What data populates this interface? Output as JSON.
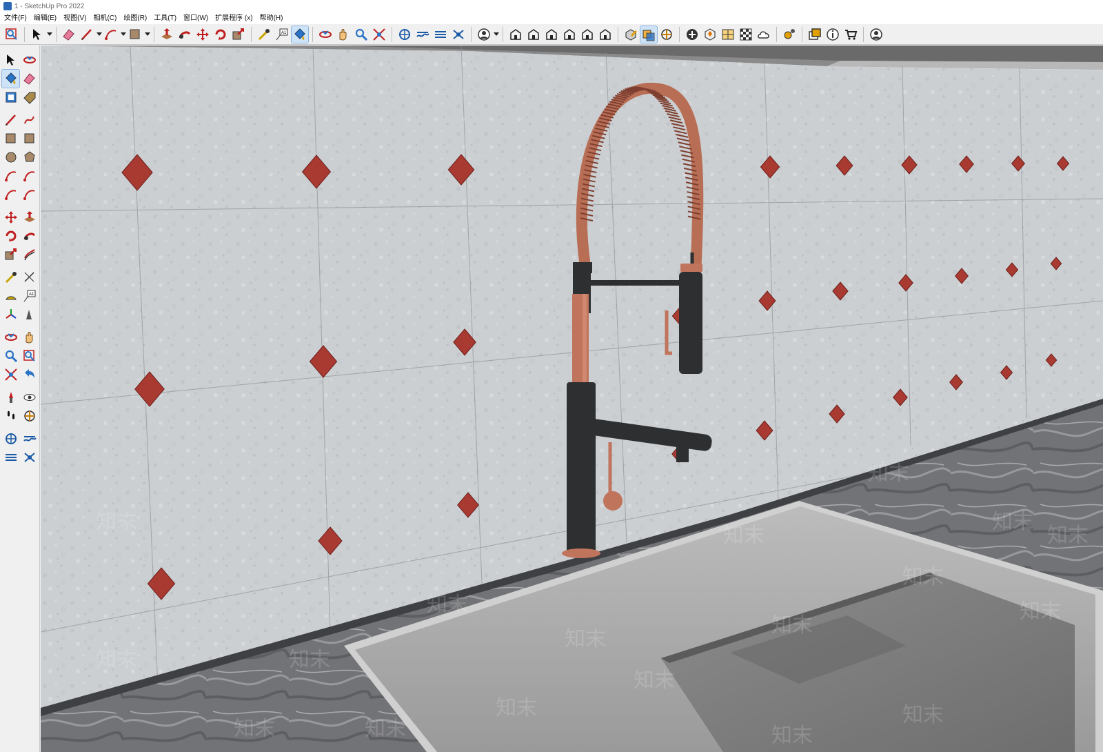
{
  "window": {
    "title": "1 - SketchUp Pro 2022"
  },
  "menu": [
    "文件(F)",
    "编辑(E)",
    "视图(V)",
    "相机(C)",
    "绘图(R)",
    "工具(T)",
    "窗口(W)",
    "扩展程序 (x)",
    "帮助(H)"
  ],
  "top_toolbar": [
    {
      "name": "zoom-window-icon",
      "type": "btn"
    },
    {
      "type": "sep"
    },
    {
      "name": "select-icon",
      "type": "btn"
    },
    {
      "type": "drop"
    },
    {
      "type": "sep"
    },
    {
      "name": "eraser-icon",
      "type": "btn"
    },
    {
      "name": "line-icon",
      "type": "btn"
    },
    {
      "type": "drop"
    },
    {
      "name": "arc-icon",
      "type": "btn"
    },
    {
      "type": "drop"
    },
    {
      "name": "rectangle-icon",
      "type": "btn"
    },
    {
      "type": "drop"
    },
    {
      "type": "sep"
    },
    {
      "name": "push-pull-icon",
      "type": "btn"
    },
    {
      "name": "follow-me-icon",
      "type": "btn"
    },
    {
      "name": "move-icon",
      "type": "btn"
    },
    {
      "name": "rotate-icon",
      "type": "btn"
    },
    {
      "name": "scale-icon",
      "type": "btn"
    },
    {
      "type": "sep"
    },
    {
      "name": "tape-measure-icon",
      "type": "btn"
    },
    {
      "name": "text-icon",
      "type": "btn"
    },
    {
      "name": "paint-bucket-icon",
      "type": "btn",
      "active": true
    },
    {
      "type": "sep"
    },
    {
      "name": "orbit-icon",
      "type": "btn"
    },
    {
      "name": "pan-icon",
      "type": "btn"
    },
    {
      "name": "zoom-icon",
      "type": "btn"
    },
    {
      "name": "zoom-extents-icon",
      "type": "btn"
    },
    {
      "type": "sep"
    },
    {
      "name": "warehouse-icon",
      "type": "btn"
    },
    {
      "name": "extension-warehouse-icon",
      "type": "btn"
    },
    {
      "name": "layout-icon",
      "type": "btn"
    },
    {
      "name": "extension-manager-icon",
      "type": "btn"
    },
    {
      "type": "sep"
    },
    {
      "name": "user-account-icon",
      "type": "btn"
    },
    {
      "type": "drop"
    },
    {
      "type": "sep"
    },
    {
      "name": "iso-view-icon",
      "type": "btn"
    },
    {
      "name": "top-view-icon",
      "type": "btn"
    },
    {
      "name": "front-view-icon",
      "type": "btn"
    },
    {
      "name": "right-view-icon",
      "type": "btn"
    },
    {
      "name": "back-view-icon",
      "type": "btn"
    },
    {
      "name": "left-view-icon",
      "type": "btn"
    },
    {
      "type": "sep"
    },
    {
      "name": "solid-inspector-icon",
      "type": "btn"
    },
    {
      "name": "outer-shell-icon",
      "type": "btn",
      "active": true
    },
    {
      "name": "section-plane-icon",
      "type": "btn"
    },
    {
      "type": "sep"
    },
    {
      "name": "add-location-icon",
      "type": "btn"
    },
    {
      "name": "sandbox-icon",
      "type": "btn"
    },
    {
      "name": "match-photo-icon",
      "type": "btn"
    },
    {
      "name": "styles-icon",
      "type": "btn"
    },
    {
      "name": "cloud-icon",
      "type": "btn"
    },
    {
      "type": "sep"
    },
    {
      "name": "settings-icon",
      "type": "btn"
    },
    {
      "type": "sep"
    },
    {
      "name": "window-icon",
      "type": "btn"
    },
    {
      "name": "info-icon",
      "type": "btn"
    },
    {
      "name": "cart-icon",
      "type": "btn"
    },
    {
      "type": "sep"
    },
    {
      "name": "profile-icon",
      "type": "btn"
    }
  ],
  "left_toolbar": [
    "select-icon",
    "orbit-icon",
    "paint-bucket-icon",
    "eraser-icon",
    "components-icon",
    "tag-icon",
    "gap",
    "line-icon",
    "freehand-icon",
    "rectangle-icon",
    "rotated-rectangle-icon",
    "circle-icon",
    "polygon-icon",
    "arc-icon",
    "two-point-arc-icon",
    "three-point-arc-icon",
    "pie-icon",
    "gap",
    "move-icon",
    "push-pull-icon",
    "rotate-icon",
    "follow-me-icon",
    "scale-icon",
    "offset-icon",
    "gap",
    "tape-measure-icon",
    "dimension-icon",
    "protractor-icon",
    "text-icon",
    "axes-icon",
    "3d-text-icon",
    "gap",
    "orbit-view-icon",
    "pan-icon",
    "zoom-icon",
    "zoom-window-icon",
    "zoom-extents-icon",
    "previous-view-icon",
    "gap",
    "position-camera-icon",
    "look-around-icon",
    "walk-icon",
    "section-plane-icon",
    "gap",
    "warehouse-icon",
    "extension-warehouse-icon",
    "layout-icon",
    "extension-manager-icon"
  ],
  "left_toolbar_active": [
    "paint-bucket-icon"
  ],
  "viewport": {
    "watermark_text": "知末",
    "colors": {
      "tile": "#c9cccf",
      "tile_dark": "#b5b9bd",
      "accent_tile": "#a83a32",
      "countertop": "#6a6b6e",
      "sink": "#aaaaaa",
      "faucet_black": "#2d2f30",
      "faucet_copper": "#c0745c"
    }
  }
}
